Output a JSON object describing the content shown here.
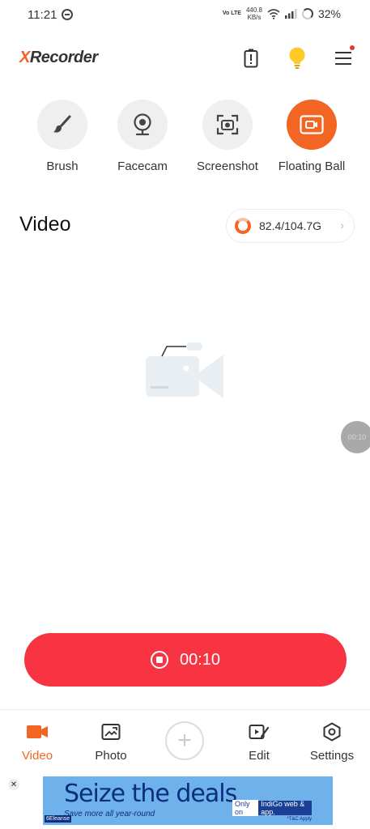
{
  "status_bar": {
    "time": "11:21",
    "network_type": "Vo LTE",
    "speed": "440.8",
    "speed_unit": "KB/s",
    "battery": "32%"
  },
  "header": {
    "logo_prefix": "X",
    "logo_rest": "Recorder"
  },
  "tools": [
    {
      "label": "Brush",
      "icon": "brush-icon"
    },
    {
      "label": "Facecam",
      "icon": "webcam-icon"
    },
    {
      "label": "Screenshot",
      "icon": "screenshot-icon"
    },
    {
      "label": "Floating Ball",
      "icon": "floating-ball-icon"
    }
  ],
  "video_section": {
    "title": "Video",
    "storage": "82.4/104.7G"
  },
  "floating_timer": "00:10",
  "record_button": {
    "time": "00:10"
  },
  "bottom_nav": {
    "items": [
      {
        "label": "Video",
        "icon": "video-camera-icon",
        "active": true
      },
      {
        "label": "Photo",
        "icon": "photo-icon",
        "active": false
      },
      {
        "label": "Edit",
        "icon": "edit-icon",
        "active": false
      },
      {
        "label": "Settings",
        "icon": "settings-icon",
        "active": false
      }
    ]
  },
  "ad": {
    "headline": "Seize the deals",
    "subline": "Save more all year-round",
    "cta_prefix": "Only on",
    "cta_text": "IndiGo web & app.",
    "brand": "6Eleanse",
    "tc": "*T&C Apply"
  },
  "colors": {
    "accent": "#f26522",
    "record": "#f83342"
  }
}
